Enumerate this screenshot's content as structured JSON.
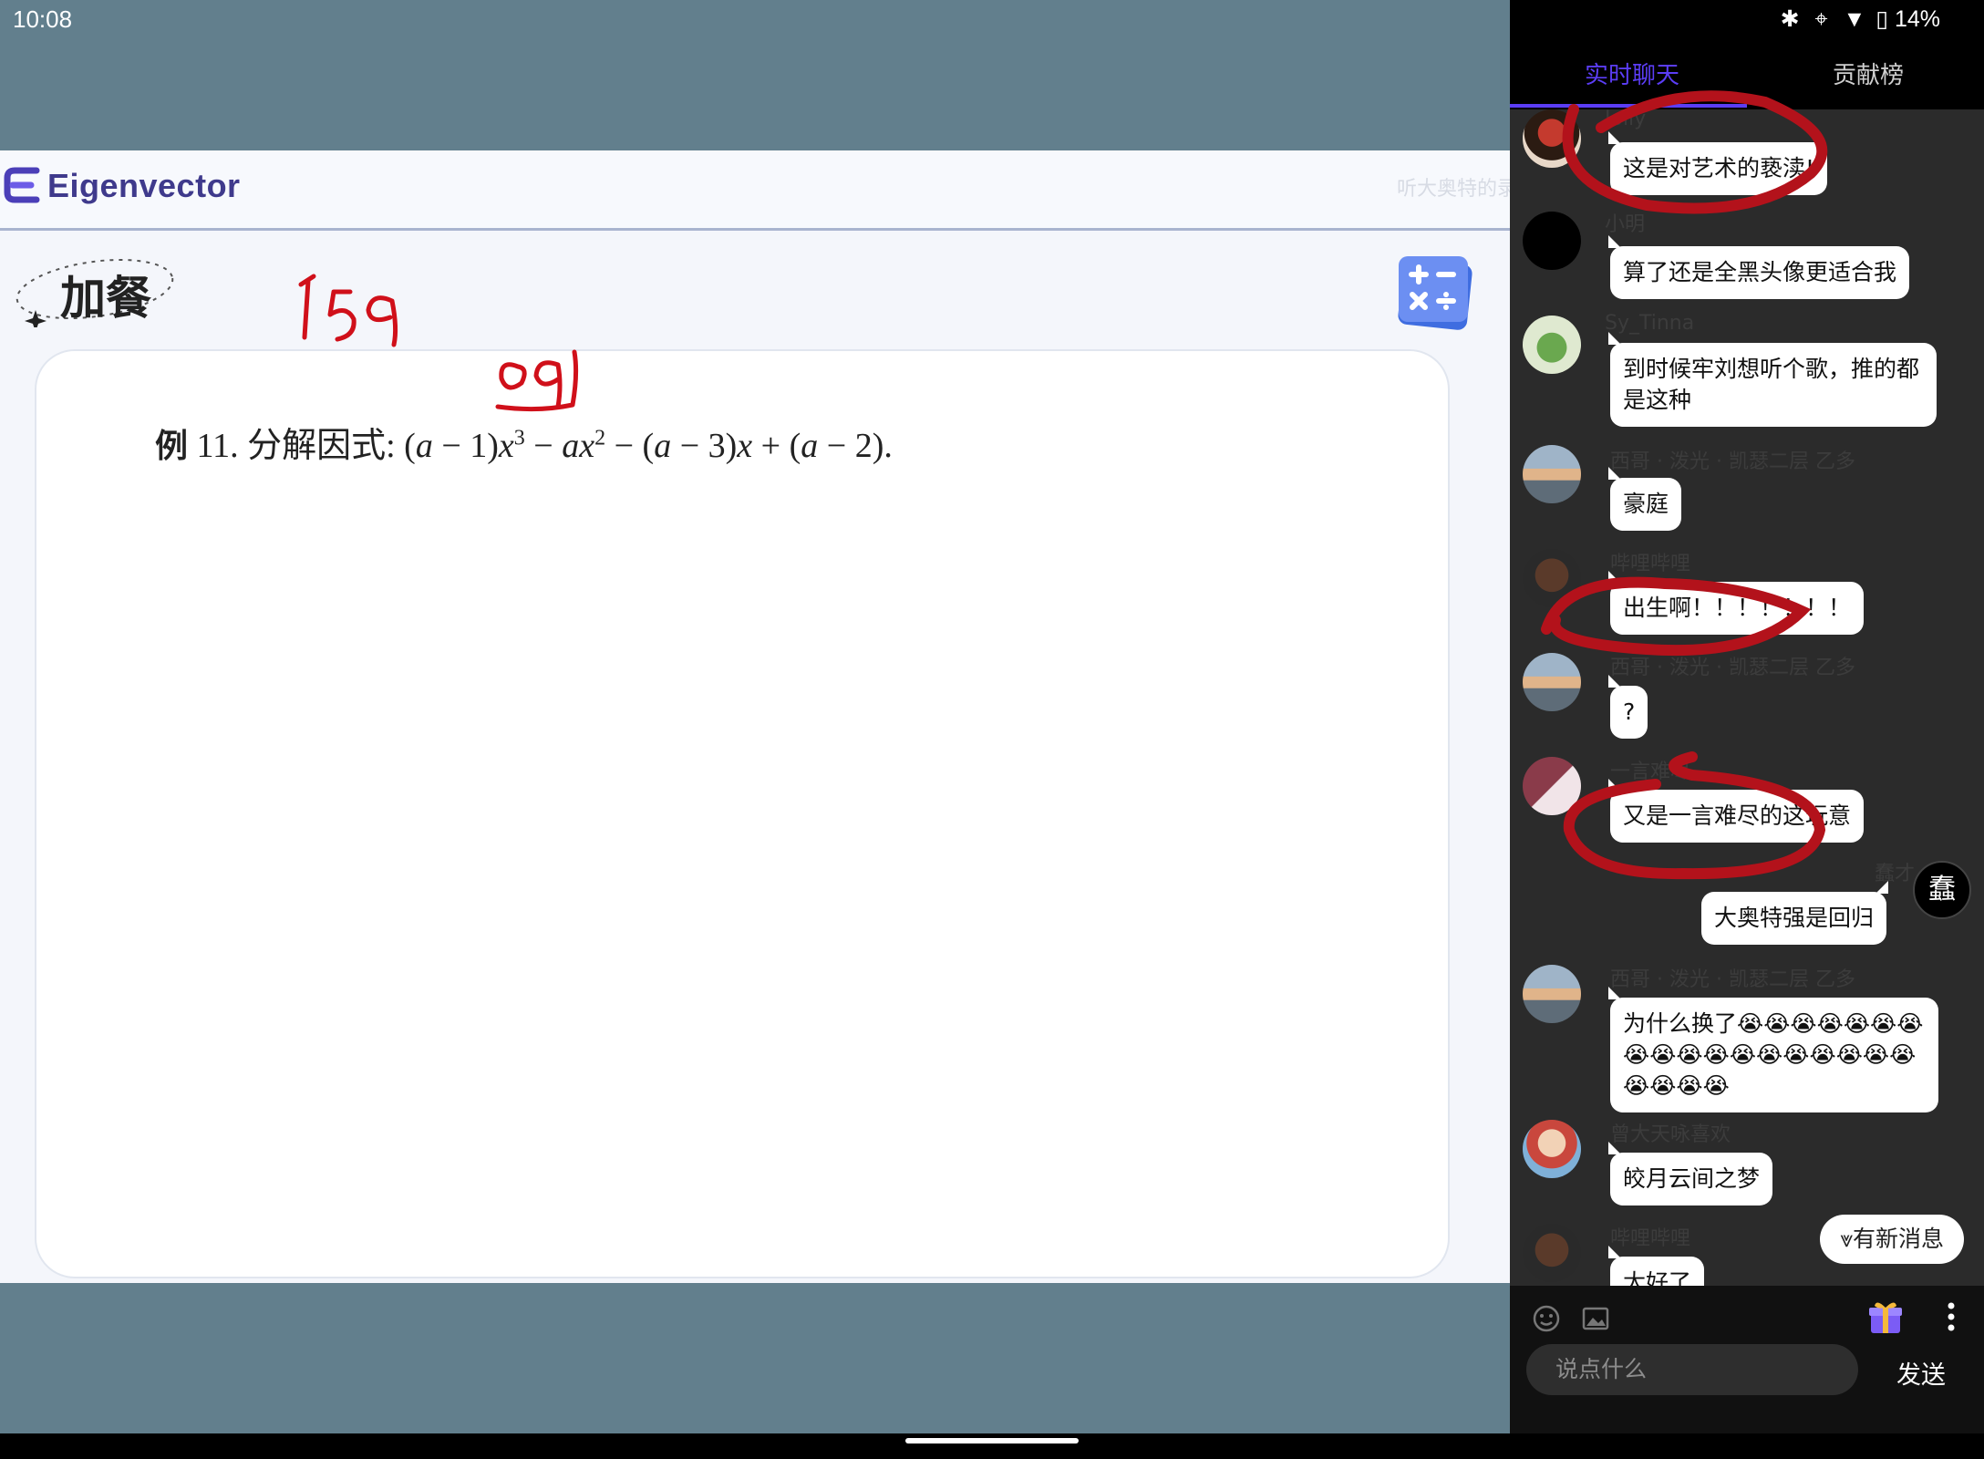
{
  "status_bar": {
    "time": "10:08",
    "battery": "14%"
  },
  "slide": {
    "brand": "Eigenvector",
    "watermark": "听大奥特的录",
    "section_label": "加餐",
    "problem_label": "例",
    "problem_number": "11.",
    "problem_prefix": "分解因式:",
    "handwriting": [
      "159",
      "09"
    ]
  },
  "chat": {
    "tabs": [
      {
        "label": "实时聊天",
        "active": true
      },
      {
        "label": "贡献榜",
        "active": false
      }
    ],
    "messages": [
      {
        "user": "Jolly",
        "text": "这是对艺术的亵渎!",
        "side": "left"
      },
      {
        "user": "小明",
        "text": "算了还是全黑头像更适合我",
        "side": "left"
      },
      {
        "user": "Sy_Tinna",
        "text": "到时候牢刘想听个歌，推的都是这种",
        "side": "left"
      },
      {
        "user": "西哥 · 泼光 · 凯瑟二层 乙多",
        "text": "豪庭",
        "side": "left"
      },
      {
        "user": "哔哩哔哩",
        "text": "出生啊！！！！！！！",
        "side": "left"
      },
      {
        "user": "西哥 · 泼光 · 凯瑟二层 乙多",
        "text": "?",
        "side": "left"
      },
      {
        "user": "一言难尽",
        "text": "又是一言难尽的这玩意",
        "side": "left"
      },
      {
        "user": "蠢才",
        "text": "大奥特强是回归",
        "side": "right"
      },
      {
        "user": "西哥 · 泼光 · 凯瑟二层 乙多",
        "text": "为什么换了😭😭😭😭😭😭😭😭😭😭😭😭😭😭😭😭😭😭😭😭😭😭",
        "side": "left"
      },
      {
        "user": "曾大天咏喜欢",
        "text": "皎月云间之梦",
        "side": "left"
      },
      {
        "user": "哔哩哔哩",
        "text": "太好了",
        "side": "left"
      }
    ],
    "new_messages_label": "有新消息",
    "input_placeholder": "说点什么",
    "send_label": "发送"
  },
  "icons": [
    "bluetooth-icon",
    "location-icon",
    "wifi-icon",
    "battery-icon",
    "emoji-icon",
    "image-icon",
    "gift-icon",
    "more-icon",
    "calculator-icon"
  ],
  "colors": {
    "accent": "#5b3df5",
    "video_bg": "#627f8d",
    "chat_bg": "#2b2b2b",
    "annotation_red": "#b3121b"
  }
}
